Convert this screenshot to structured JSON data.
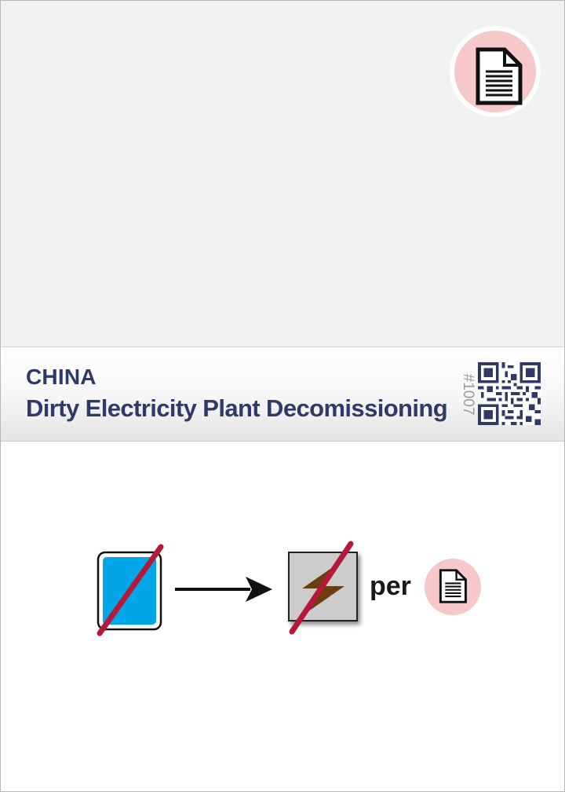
{
  "card": {
    "country": "CHINA",
    "title": "Dirty Electricity Plant Decomissioning",
    "number": "#1007"
  },
  "icons": {
    "corner": "document-icon",
    "source": "blue-card-icon",
    "target": "electricity-icon",
    "per": "document-icon",
    "qr": "qr-code-icon"
  },
  "effect": {
    "per_label": "per"
  },
  "colors": {
    "title_text": "#2f3a66",
    "badge_fill": "#f6c8c8",
    "card_blue": "#00a6e8",
    "strike_red": "#b5193a",
    "electricity_brown": "#6b3e12",
    "tile_gray": "#cccccc"
  }
}
